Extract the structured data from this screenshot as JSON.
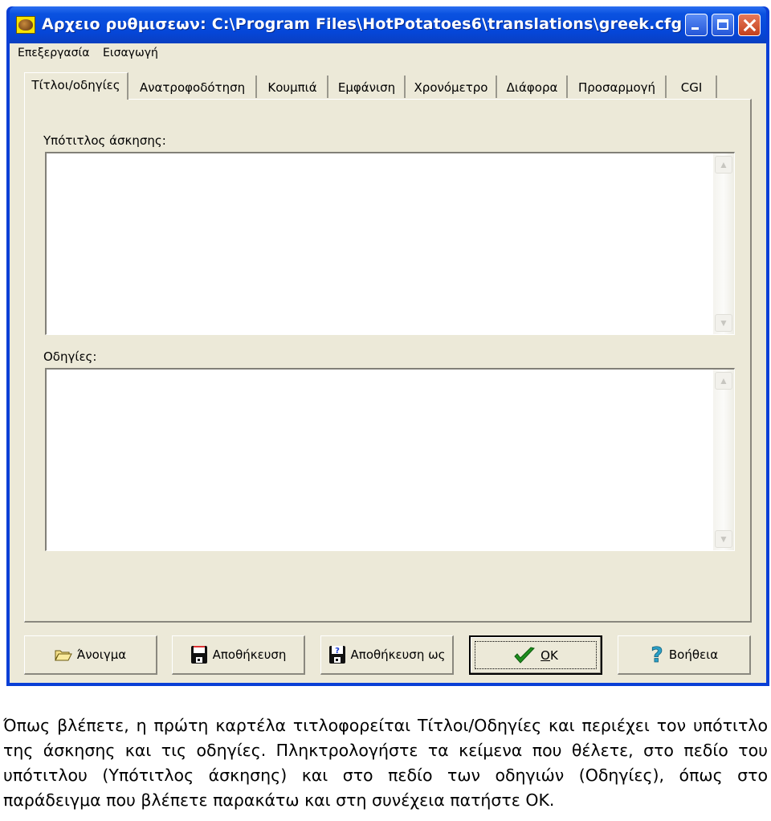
{
  "window": {
    "title": "Αρχειο ρυθμισεων:  C:\\Program Files\\HotPotatoes6\\translations\\greek.cfg",
    "controls": {
      "minimize": "minimize",
      "maximize": "maximize",
      "close": "close"
    }
  },
  "menubar": {
    "items": [
      {
        "label": "Επεξεργασία"
      },
      {
        "label": "Εισαγωγή"
      }
    ]
  },
  "tabs": [
    {
      "label": "Τίτλοι/οδηγίες",
      "active": true
    },
    {
      "label": "Ανατροφοδότηση",
      "active": false
    },
    {
      "label": "Κουμπιά",
      "active": false
    },
    {
      "label": "Εμφάνιση",
      "active": false
    },
    {
      "label": "Χρονόμετρο",
      "active": false
    },
    {
      "label": "Διάφορα",
      "active": false
    },
    {
      "label": "Προσαρμογή",
      "active": false
    },
    {
      "label": "CGI",
      "active": false
    }
  ],
  "fields": {
    "subtitle": {
      "label": "Υπότιτλος άσκησης:",
      "value": ""
    },
    "instructions": {
      "label": "Οδηγίες:",
      "value": ""
    }
  },
  "buttons": {
    "open": {
      "label": "Άνοιγμα",
      "icon": "folder-open-icon"
    },
    "save": {
      "label": "Αποθήκευση",
      "icon": "floppy-disk-icon"
    },
    "save_as": {
      "label": "Αποθήκευση ως",
      "icon": "floppy-disk-question-icon"
    },
    "ok": {
      "label_first": "O",
      "label_rest": "K",
      "icon": "checkmark-icon"
    },
    "help": {
      "label": "Βοήθεια",
      "icon": "question-mark-icon"
    }
  },
  "caption": "Όπως βλέπετε, η πρώτη καρτέλα τιτλοφορείται Τίτλοι/Οδηγίες και περιέχει τον υπότιτλο της άσκησης και τις οδηγίες. Πληκτρολογήστε τα κείμενα που θέλετε, στο πεδίο του υπότιτλου (Υπότιτλος άσκησης) και στο πεδίο των οδηγιών (Οδηγίες), όπως στο παράδειγμα που βλέπετε παρακάτω και στη συνέχεια πατήστε OK."
}
